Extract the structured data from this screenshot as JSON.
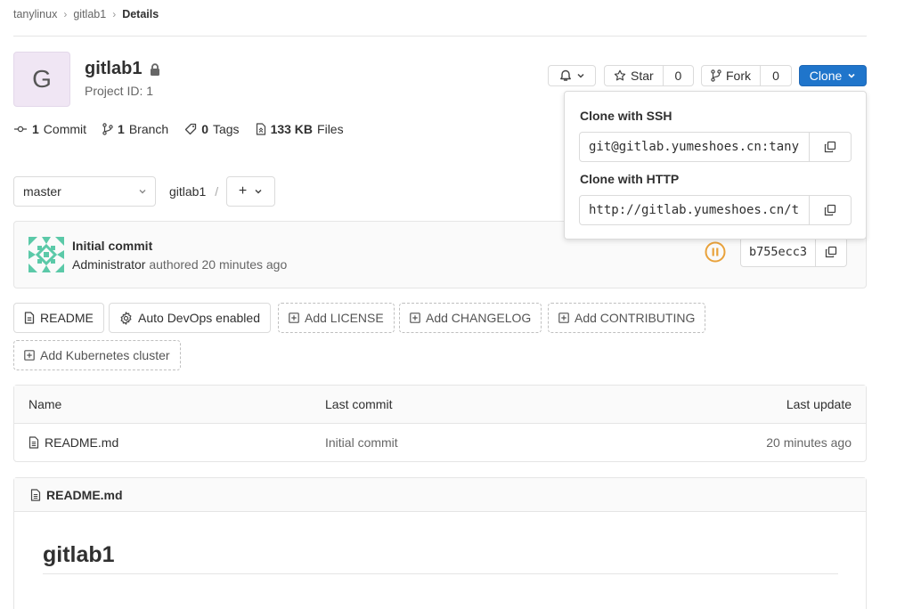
{
  "breadcrumb": {
    "items": [
      "tanylinux",
      "gitlab1",
      "Details"
    ]
  },
  "project": {
    "avatar_letter": "G",
    "name": "gitlab1",
    "id_text": "Project ID: 1"
  },
  "header_actions": {
    "star_label": "Star",
    "star_count": "0",
    "fork_label": "Fork",
    "fork_count": "0",
    "clone_label": "Clone"
  },
  "stats": [
    {
      "count": "1",
      "label": "Commit"
    },
    {
      "count": "1",
      "label": "Branch"
    },
    {
      "count": "0",
      "label": "Tags"
    },
    {
      "count": "133 KB",
      "label": "Files"
    }
  ],
  "branch": {
    "selected": "master",
    "path": "gitlab1",
    "separator": "/",
    "add_label": "+"
  },
  "commit": {
    "title": "Initial commit",
    "author": "Administrator",
    "meta": "authored 20 minutes ago",
    "sha": "b755ecc3"
  },
  "quick_actions": {
    "readme": "README",
    "auto_devops": "Auto DevOps enabled",
    "add_license": "Add LICENSE",
    "add_changelog": "Add CHANGELOG",
    "add_contributing": "Add CONTRIBUTING",
    "add_kubernetes": "Add Kubernetes cluster"
  },
  "file_table": {
    "columns": [
      "Name",
      "Last commit",
      "Last update"
    ],
    "rows": [
      {
        "name": "README.md",
        "last_commit": "Initial commit",
        "last_update": "20 minutes ago"
      }
    ]
  },
  "readme": {
    "filename": "README.md",
    "heading": "gitlab1"
  },
  "clone_dropdown": {
    "ssh_label": "Clone with SSH",
    "ssh_url": "git@gitlab.yumeshoes.cn:tany",
    "http_label": "Clone with HTTP",
    "http_url": "http://gitlab.yumeshoes.cn/t"
  },
  "colors": {
    "primary": "#1f75cb",
    "avatar_bg": "#f0e6f4",
    "pipeline": "#e9a23b",
    "identicon": "#5bc9a8"
  }
}
